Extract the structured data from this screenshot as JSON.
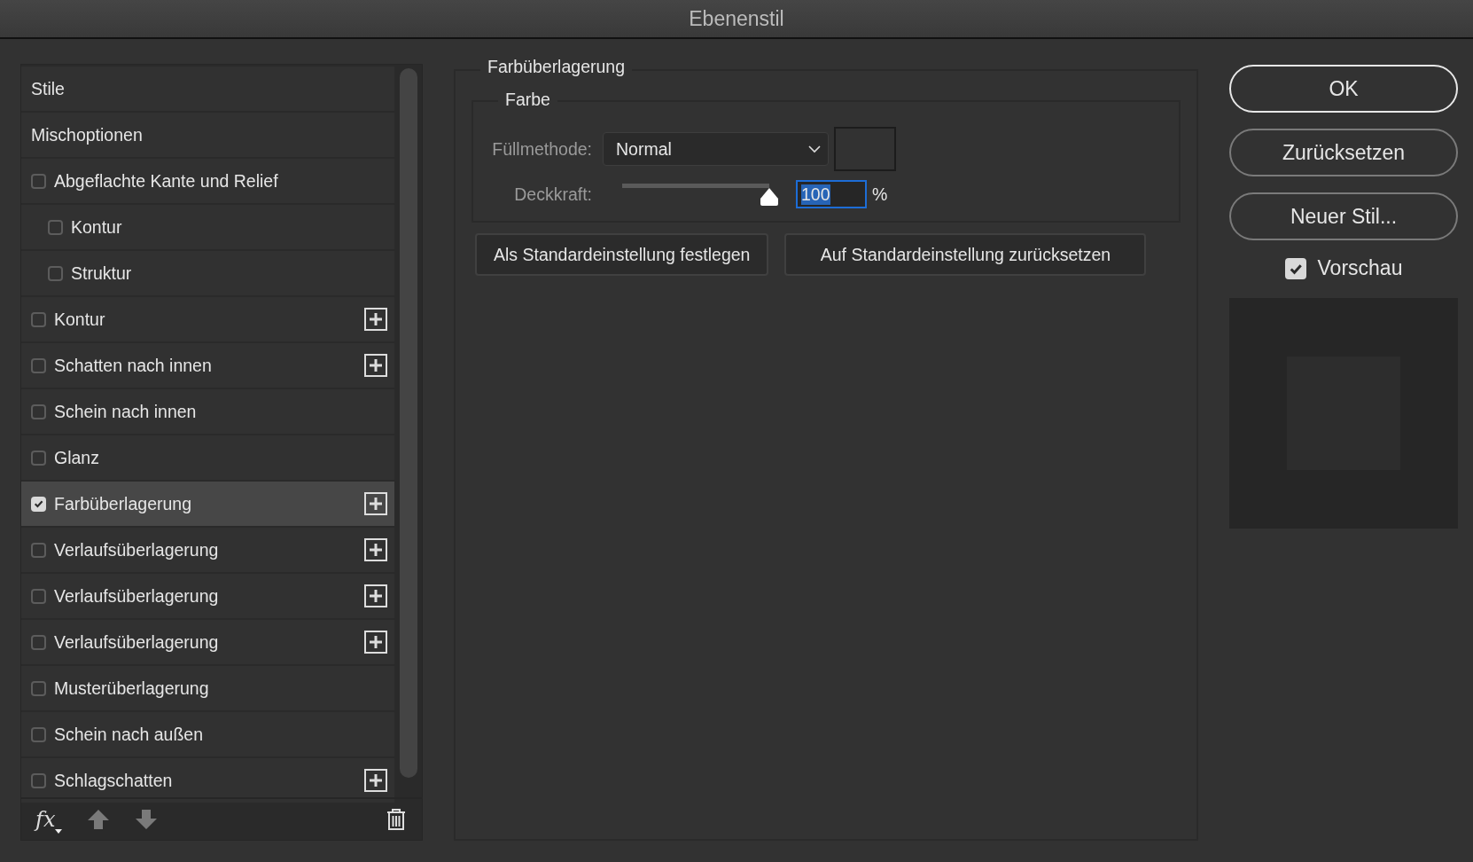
{
  "window": {
    "title": "Ebenenstil"
  },
  "styles_list": {
    "items": [
      {
        "kind": "header",
        "label": "Stile",
        "selected": false
      },
      {
        "kind": "header",
        "label": "Mischoptionen",
        "selected": false
      },
      {
        "kind": "effect",
        "label": "Abgeflachte Kante und Relief",
        "checked": false,
        "selected": false,
        "add_button": false,
        "children": [
          {
            "kind": "effect",
            "label": "Kontur",
            "checked": false,
            "selected": false,
            "add_button": false
          },
          {
            "kind": "effect",
            "label": "Struktur",
            "checked": false,
            "selected": false,
            "add_button": false
          }
        ]
      },
      {
        "kind": "effect",
        "label": "Kontur",
        "checked": false,
        "selected": false,
        "add_button": true
      },
      {
        "kind": "effect",
        "label": "Schatten nach innen",
        "checked": false,
        "selected": false,
        "add_button": true
      },
      {
        "kind": "effect",
        "label": "Schein nach innen",
        "checked": false,
        "selected": false,
        "add_button": false
      },
      {
        "kind": "effect",
        "label": "Glanz",
        "checked": false,
        "selected": false,
        "add_button": false
      },
      {
        "kind": "effect",
        "label": "Farbüberlagerung",
        "checked": true,
        "selected": true,
        "add_button": true
      },
      {
        "kind": "effect",
        "label": "Verlaufsüberlagerung",
        "checked": false,
        "selected": false,
        "add_button": true
      },
      {
        "kind": "effect",
        "label": "Verlaufsüberlagerung",
        "checked": false,
        "selected": false,
        "add_button": true
      },
      {
        "kind": "effect",
        "label": "Verlaufsüberlagerung",
        "checked": false,
        "selected": false,
        "add_button": true
      },
      {
        "kind": "effect",
        "label": "Musterüberlagerung",
        "checked": false,
        "selected": false,
        "add_button": false
      },
      {
        "kind": "effect",
        "label": "Schein nach außen",
        "checked": false,
        "selected": false,
        "add_button": false
      },
      {
        "kind": "effect",
        "label": "Schlagschatten",
        "checked": false,
        "selected": false,
        "add_button": true
      }
    ],
    "footer": {
      "fx_label": "fx"
    }
  },
  "settings": {
    "title": "Farbüberlagerung",
    "group_title": "Farbe",
    "blend_mode": {
      "label": "Füllmethode:",
      "value": "Normal"
    },
    "opacity": {
      "label": "Deckkraft:",
      "level": 1.0,
      "value": "100",
      "unit": "%"
    },
    "buttons": [
      "Als Standardeinstellung festlegen",
      "Auf Standardeinstellung zurücksetzen"
    ]
  },
  "actions": {
    "buttons": [
      {
        "label": "OK",
        "default": true
      },
      {
        "label": "Zurücksetzen",
        "default": false
      },
      {
        "label": "Neuer Stil...",
        "default": false
      }
    ],
    "preview": {
      "label": "Vorschau",
      "checked": true
    }
  }
}
